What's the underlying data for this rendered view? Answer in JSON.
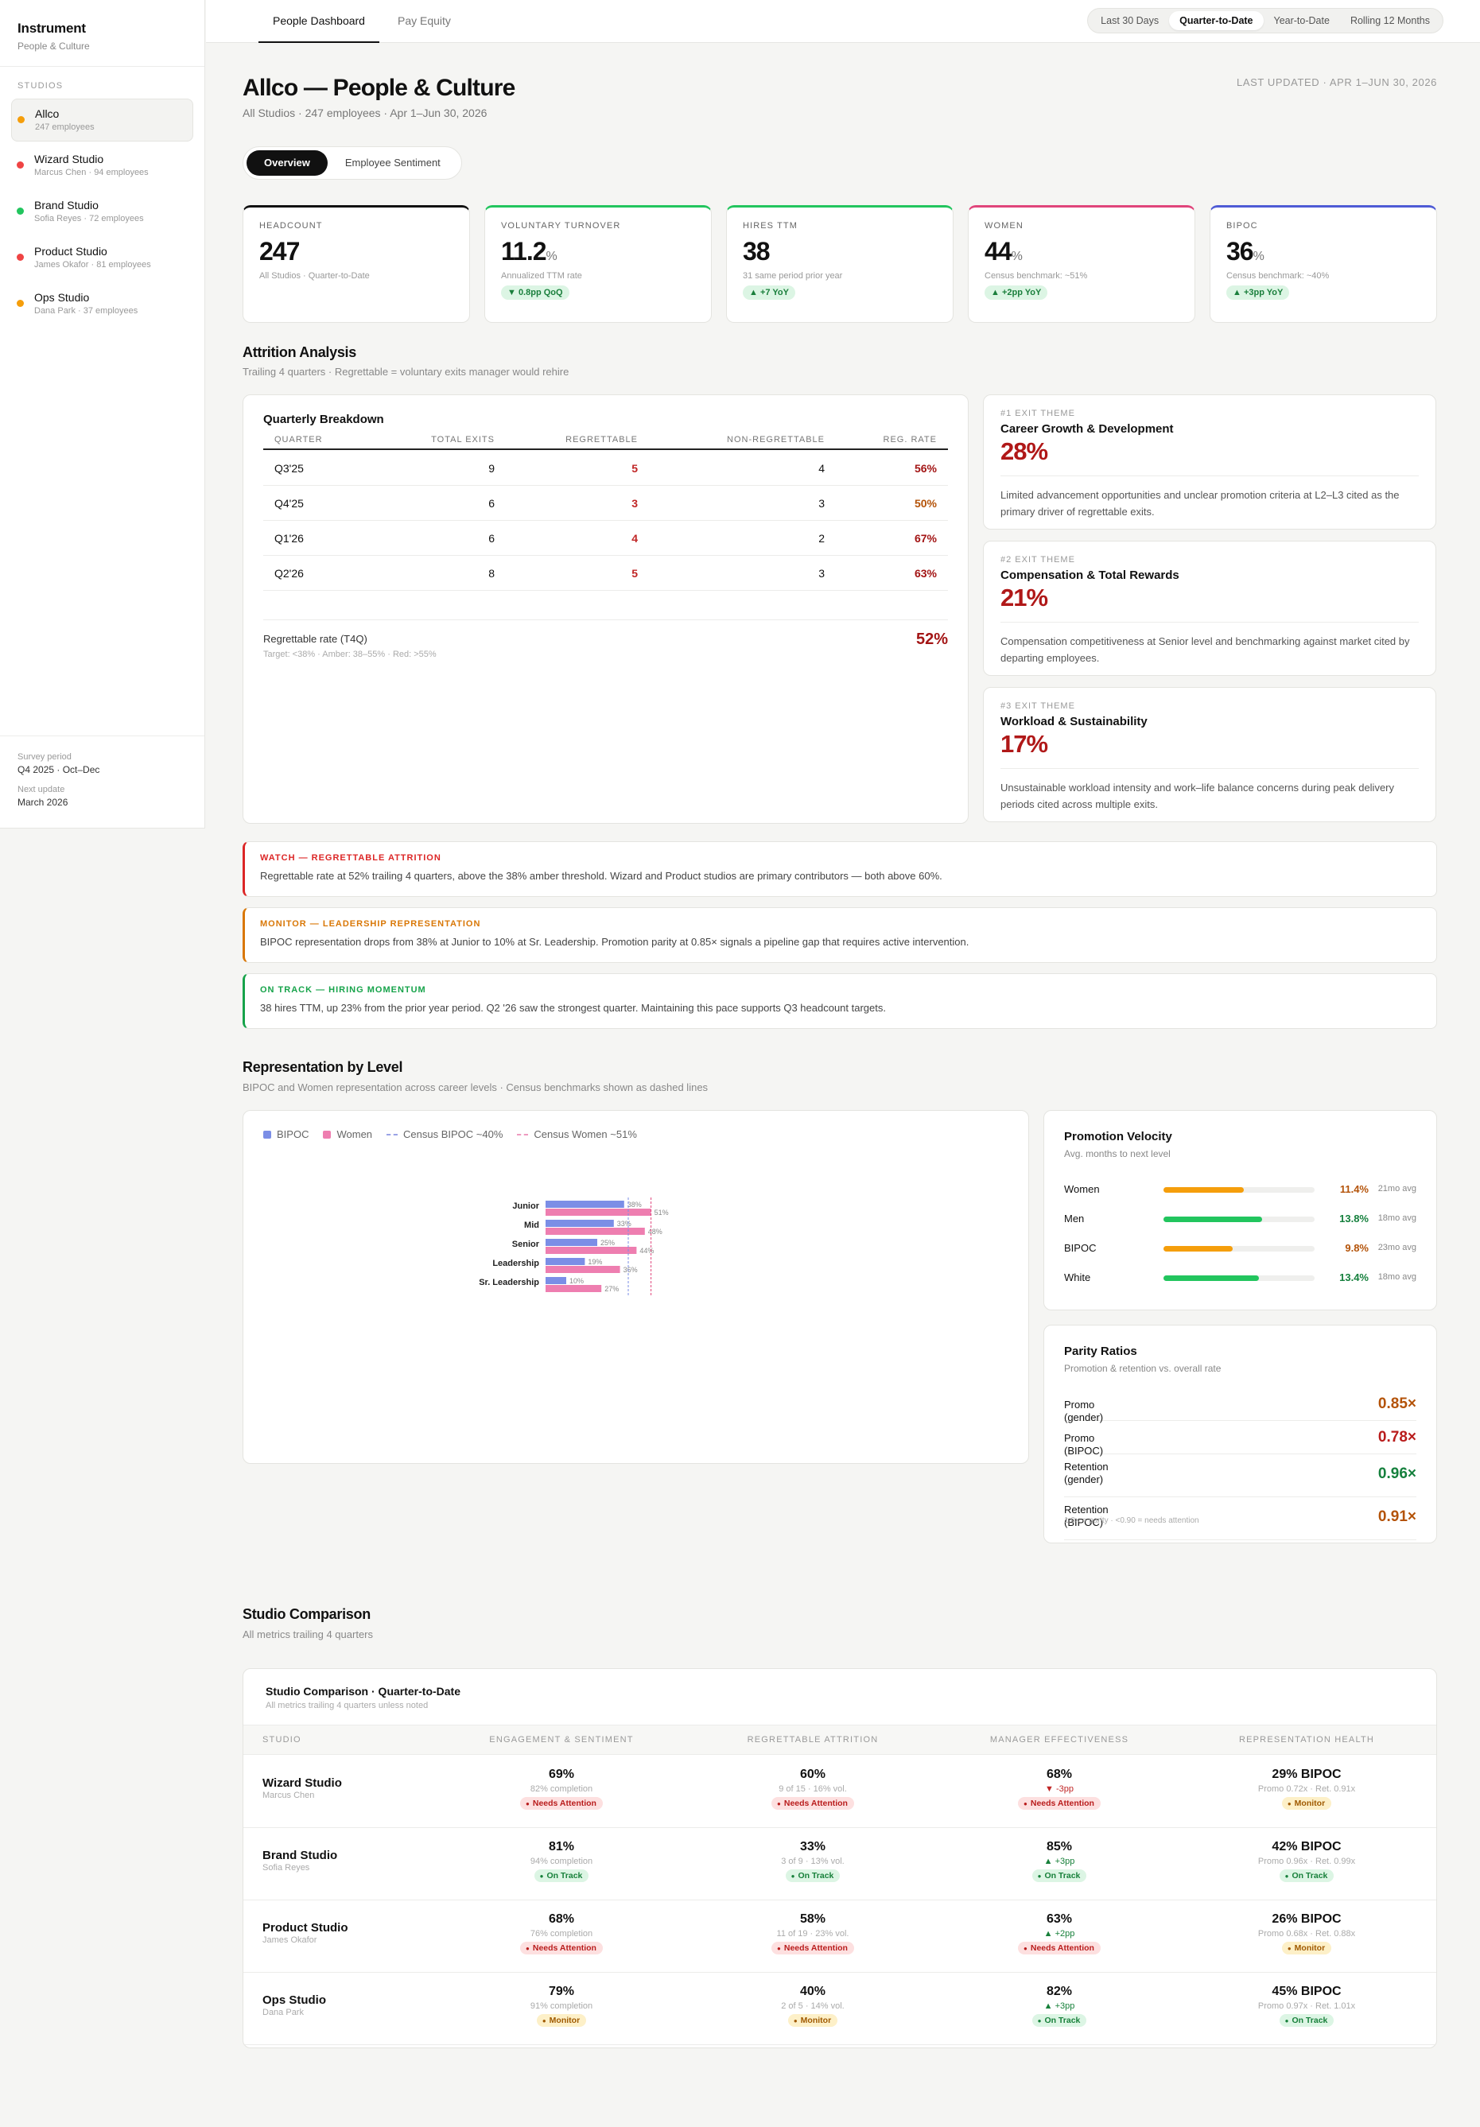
{
  "app": {
    "title": "Instrument",
    "subtitle": "People & Culture"
  },
  "sidebar": {
    "section_label": "STUDIOS",
    "studios": [
      {
        "name": "Allco",
        "meta": "247 employees",
        "color": "#f59e0b"
      },
      {
        "name": "Wizard Studio",
        "meta": "Marcus Chen · 94 employees",
        "color": "#ef4444"
      },
      {
        "name": "Brand Studio",
        "meta": "Sofia Reyes · 72 employees",
        "color": "#22c55e"
      },
      {
        "name": "Product Studio",
        "meta": "James Okafor · 81 employees",
        "color": "#ef4444"
      },
      {
        "name": "Ops Studio",
        "meta": "Dana Park · 37 employees",
        "color": "#f59e0b"
      }
    ],
    "footer": {
      "survey_label": "Survey period",
      "survey_value": "Q4 2025 · Oct–Dec",
      "next_label": "Next update",
      "next_value": "March 2026"
    }
  },
  "topnav": {
    "tabs": [
      "People Dashboard",
      "Pay Equity"
    ],
    "ranges": [
      "Last 30 Days",
      "Quarter-to-Date",
      "Year-to-Date",
      "Rolling 12 Months"
    ]
  },
  "header": {
    "title": "Allco — People & Culture",
    "subtitle": "All Studios · 247 employees · Apr 1–Jun 30, 2026",
    "updated": "LAST UPDATED · APR 1–JUN 30, 2026",
    "toggle": [
      "Overview",
      "Employee Sentiment"
    ]
  },
  "kpis": [
    {
      "label": "HEADCOUNT",
      "value": "247",
      "unit": "",
      "sub": "All Studios · Quarter-to-Date",
      "badge": "",
      "color": "#111111"
    },
    {
      "label": "VOLUNTARY TURNOVER",
      "value": "11.2",
      "unit": "%",
      "sub": "Annualized TTM rate",
      "badge": "▼ 0.8pp QoQ",
      "color": "#22c55e"
    },
    {
      "label": "HIRES TTM",
      "value": "38",
      "unit": "",
      "sub": "31 same period prior year",
      "badge": "▲ +7 YoY",
      "color": "#22c55e"
    },
    {
      "label": "WOMEN",
      "value": "44",
      "unit": "%",
      "sub": "Census benchmark: ~51%",
      "badge": "▲ +2pp YoY",
      "color": "#e0457b"
    },
    {
      "label": "BIPOC",
      "value": "36",
      "unit": "%",
      "sub": "Census benchmark: ~40%",
      "badge": "▲ +3pp YoY",
      "color": "#4f5bd5"
    }
  ],
  "attrition": {
    "title": "Attrition Analysis",
    "subtitle": "Trailing 4 quarters · Regrettable = voluntary exits manager would rehire",
    "table_title": "Quarterly Breakdown",
    "headers": [
      "QUARTER",
      "TOTAL EXITS",
      "REGRETTABLE",
      "NON-REGRETTABLE",
      "REG. RATE"
    ],
    "rows": [
      {
        "q": "Q3'25",
        "total": "9",
        "reg": "5",
        "non": "4",
        "rate": "56%"
      },
      {
        "q": "Q4'25",
        "total": "6",
        "reg": "3",
        "non": "3",
        "rate": "50%"
      },
      {
        "q": "Q1'26",
        "total": "6",
        "reg": "4",
        "non": "2",
        "rate": "67%"
      },
      {
        "q": "Q2'26",
        "total": "8",
        "reg": "5",
        "non": "3",
        "rate": "63%"
      }
    ],
    "summary_label": "Regrettable rate (T4Q)",
    "summary_value": "52%",
    "summary_note": "Target: <38% · Amber: 38–55% · Red: >55%",
    "themes": [
      {
        "label": "#1 EXIT THEME",
        "name": "Career Growth & Development",
        "pct": "28%",
        "desc": "Limited advancement opportunities and unclear promotion criteria at L2–L3 cited as the primary driver of regrettable exits."
      },
      {
        "label": "#2 EXIT THEME",
        "name": "Compensation & Total Rewards",
        "pct": "21%",
        "desc": "Compensation competitiveness at Senior level and benchmarking against market cited by departing employees."
      },
      {
        "label": "#3 EXIT THEME",
        "name": "Workload & Sustainability",
        "pct": "17%",
        "desc": "Unsustainable workload intensity and work–life balance concerns during peak delivery periods cited across multiple exits."
      }
    ]
  },
  "alerts": [
    {
      "title": "WATCH — REGRETTABLE ATTRITION",
      "body": "Regrettable rate at 52% trailing 4 quarters, above the 38% amber threshold. Wizard and Product studios are primary contributors — both above 60%.",
      "color": "#dc2626"
    },
    {
      "title": "MONITOR — LEADERSHIP REPRESENTATION",
      "body": "BIPOC representation drops from 38% at Junior to 10% at Sr. Leadership. Promotion parity at 0.85× signals a pipeline gap that requires active intervention.",
      "color": "#d97706"
    },
    {
      "title": "ON TRACK — HIRING MOMENTUM",
      "body": "38 hires TTM, up 23% from the prior year period. Q2 '26 saw the strongest quarter. Maintaining this pace supports Q3 headcount targets.",
      "color": "#16a34a"
    }
  ],
  "representation": {
    "title": "Representation by Level",
    "subtitle": "BIPOC and Women representation across career levels · Census benchmarks shown as dashed lines",
    "legend": [
      "BIPOC",
      "Women",
      "Census BIPOC ~40%",
      "Census Women ~51%"
    ]
  },
  "chart_data": {
    "type": "bar",
    "orientation": "horizontal",
    "categories": [
      "Junior",
      "Mid",
      "Senior",
      "Leadership",
      "Sr. Leadership"
    ],
    "series": [
      {
        "name": "BIPOC",
        "values": [
          38,
          33,
          25,
          19,
          10
        ],
        "color": "#7b8ee6"
      },
      {
        "name": "Women",
        "values": [
          51,
          48,
          44,
          36,
          27
        ],
        "color": "#ee7eb0"
      }
    ],
    "reference_lines": [
      {
        "name": "Census BIPOC ~40%",
        "value": 40,
        "color": "#7b8ee6"
      },
      {
        "name": "Census Women ~51%",
        "value": 51,
        "color": "#e0457b"
      }
    ],
    "xlim": [
      0,
      100
    ],
    "unit": "%"
  },
  "promotion": {
    "title": "Promotion Velocity",
    "subtitle": "Avg. months to next level",
    "rows": [
      {
        "label": "Women",
        "rate": "11.4%",
        "fill": 0.53,
        "avg": "21mo avg",
        "color": "#f59e0b",
        "rate_color": "#b45309"
      },
      {
        "label": "Men",
        "rate": "13.8%",
        "fill": 0.65,
        "avg": "18mo avg",
        "color": "#22c55e",
        "rate_color": "#15803d"
      },
      {
        "label": "BIPOC",
        "rate": "9.8%",
        "fill": 0.46,
        "avg": "23mo avg",
        "color": "#f59e0b",
        "rate_color": "#b45309"
      },
      {
        "label": "White",
        "rate": "13.4%",
        "fill": 0.63,
        "avg": "18mo avg",
        "color": "#22c55e",
        "rate_color": "#15803d"
      }
    ]
  },
  "parity": {
    "title": "Parity Ratios",
    "subtitle": "Promotion & retention vs. overall rate",
    "rows": [
      {
        "label": "Promo (gender)",
        "value": "0.85×",
        "color": "#b45309"
      },
      {
        "label": "Promo (BIPOC)",
        "value": "0.78×",
        "color": "#b91c1c"
      },
      {
        "label": "Retention (gender)",
        "value": "0.96×",
        "color": "#15803d"
      },
      {
        "label": "Retention (BIPOC)",
        "value": "0.91×",
        "color": "#b45309"
      }
    ],
    "note": "1.0× = parity · <0.90 = needs attention"
  },
  "comparison": {
    "title": "Studio Comparison",
    "subtitle": "All metrics trailing 4 quarters",
    "card_title": "Studio Comparison · Quarter-to-Date",
    "card_subtitle": "All metrics trailing 4 quarters unless noted",
    "headers": [
      "STUDIO",
      "ENGAGEMENT & SENTIMENT",
      "REGRETTABLE ATTRITION",
      "MANAGER EFFECTIVENESS",
      "REPRESENTATION HEALTH"
    ],
    "rows": [
      {
        "name": "Wizard Studio",
        "lead": "Marcus Chen",
        "eng": {
          "big": "69%",
          "small": "82% completion",
          "badge": "Needs Attention",
          "tone": "red"
        },
        "att": {
          "big": "60%",
          "small": "9 of 15 · 16% vol.",
          "badge": "Needs Attention",
          "tone": "red"
        },
        "mgr": {
          "big": "68%",
          "delta": "▼ -3pp",
          "delta_tone": "red",
          "badge": "Needs Attention",
          "tone": "red"
        },
        "rep": {
          "big": "29% BIPOC",
          "small": "Promo 0.72x · Ret. 0.91x",
          "badge": "Monitor",
          "tone": "amber"
        }
      },
      {
        "name": "Brand Studio",
        "lead": "Sofia Reyes",
        "eng": {
          "big": "81%",
          "small": "94% completion",
          "badge": "On Track",
          "tone": "green"
        },
        "att": {
          "big": "33%",
          "small": "3 of 9 · 13% vol.",
          "badge": "On Track",
          "tone": "green"
        },
        "mgr": {
          "big": "85%",
          "delta": "▲ +3pp",
          "delta_tone": "green",
          "badge": "On Track",
          "tone": "green"
        },
        "rep": {
          "big": "42% BIPOC",
          "small": "Promo 0.96x · Ret. 0.99x",
          "badge": "On Track",
          "tone": "green"
        }
      },
      {
        "name": "Product Studio",
        "lead": "James Okafor",
        "eng": {
          "big": "68%",
          "small": "76% completion",
          "badge": "Needs Attention",
          "tone": "red"
        },
        "att": {
          "big": "58%",
          "small": "11 of 19 · 23% vol.",
          "badge": "Needs Attention",
          "tone": "red"
        },
        "mgr": {
          "big": "63%",
          "delta": "▲ +2pp",
          "delta_tone": "green",
          "badge": "Needs Attention",
          "tone": "red"
        },
        "rep": {
          "big": "26% BIPOC",
          "small": "Promo 0.68x · Ret. 0.88x",
          "badge": "Monitor",
          "tone": "amber"
        }
      },
      {
        "name": "Ops Studio",
        "lead": "Dana Park",
        "eng": {
          "big": "79%",
          "small": "91% completion",
          "badge": "Monitor",
          "tone": "amber"
        },
        "att": {
          "big": "40%",
          "small": "2 of 5 · 14% vol.",
          "badge": "Monitor",
          "tone": "amber"
        },
        "mgr": {
          "big": "82%",
          "delta": "▲ +3pp",
          "delta_tone": "green",
          "badge": "On Track",
          "tone": "green"
        },
        "rep": {
          "big": "45% BIPOC",
          "small": "Promo 0.97x · Ret. 1.01x",
          "badge": "On Track",
          "tone": "green"
        }
      }
    ]
  }
}
